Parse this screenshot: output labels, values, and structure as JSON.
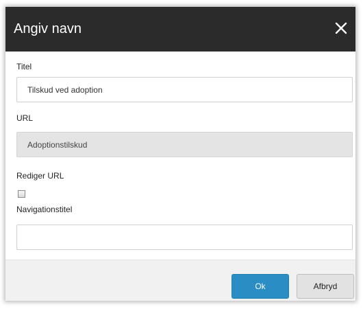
{
  "dialog": {
    "title": "Angiv navn",
    "close_icon": "close-icon"
  },
  "form": {
    "title_label": "Titel",
    "title_value": "Tilskud ved adoption",
    "url_label": "URL",
    "url_value": "Adoptionstilskud",
    "edit_url_label": "Rediger URL",
    "edit_url_checked": false,
    "nav_title_label": "Navigationstitel",
    "nav_title_value": ""
  },
  "footer": {
    "ok_label": "Ok",
    "cancel_label": "Afbryd"
  },
  "colors": {
    "titlebar": "#2b2b2b",
    "primary_button": "#2a8ec4",
    "readonly_field": "#e4e4e4",
    "footer": "#f1f1f1"
  }
}
